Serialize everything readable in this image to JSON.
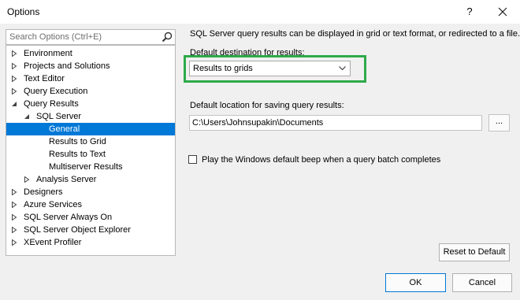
{
  "window": {
    "title": "Options",
    "help_label": "?"
  },
  "search": {
    "placeholder": "Search Options (Ctrl+E)"
  },
  "tree": {
    "items": [
      {
        "label": "Environment",
        "state": "collapsed"
      },
      {
        "label": "Projects and Solutions",
        "state": "collapsed"
      },
      {
        "label": "Text Editor",
        "state": "collapsed"
      },
      {
        "label": "Query Execution",
        "state": "collapsed"
      },
      {
        "label": "Query Results",
        "state": "expanded"
      },
      {
        "label": "SQL Server",
        "state": "expanded"
      },
      {
        "label": "General",
        "state": "leaf",
        "selected": true
      },
      {
        "label": "Results to Grid",
        "state": "leaf"
      },
      {
        "label": "Results to Text",
        "state": "leaf"
      },
      {
        "label": "Multiserver Results",
        "state": "leaf"
      },
      {
        "label": "Analysis Server",
        "state": "collapsed"
      },
      {
        "label": "Designers",
        "state": "collapsed"
      },
      {
        "label": "Azure Services",
        "state": "collapsed"
      },
      {
        "label": "SQL Server Always On",
        "state": "collapsed"
      },
      {
        "label": "SQL Server Object Explorer",
        "state": "collapsed"
      },
      {
        "label": "XEvent Profiler",
        "state": "collapsed"
      }
    ]
  },
  "panel": {
    "description": "SQL Server query results can be displayed in grid or text format, or redirected to a file.",
    "destination_label": "Default destination for results:",
    "destination_value": "Results to grids",
    "location_label": "Default location for saving query results:",
    "location_value": "C:\\Users\\Johnsupakin\\Documents",
    "browse_label": "...",
    "beep_label": "Play the Windows default beep when a query batch completes",
    "beep_checked": false
  },
  "buttons": {
    "reset": "Reset to Default",
    "ok": "OK",
    "cancel": "Cancel"
  },
  "colors": {
    "selection": "#0078d7",
    "highlight_border": "#2eaa4a",
    "dialog_background": "#f0f0f0"
  }
}
